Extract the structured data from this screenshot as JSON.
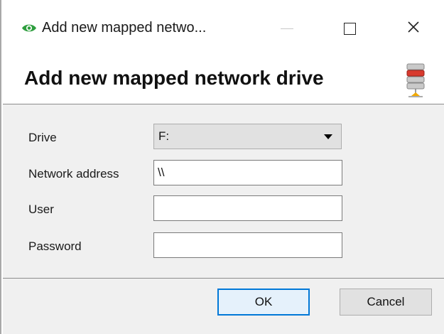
{
  "window": {
    "title": "Add new mapped netwo...",
    "app_icon": "eye-icon",
    "controls": {
      "minimize": "minimize-icon",
      "maximize": "maximize-icon",
      "close_glyph": "✕"
    }
  },
  "header": {
    "title": "Add new mapped network drive",
    "icon": "server-icon"
  },
  "form": {
    "drive": {
      "label": "Drive",
      "value": "F:"
    },
    "network_address": {
      "label": "Network address",
      "value": "\\\\"
    },
    "user": {
      "label": "User",
      "value": ""
    },
    "password": {
      "label": "Password",
      "value": ""
    }
  },
  "buttons": {
    "ok_label": "OK",
    "cancel_label": "Cancel"
  },
  "colors": {
    "app_icon_green": "#2e9e3e",
    "primary_button_border": "#0078d7",
    "primary_button_bg": "#e5f1fb",
    "panel_bg": "#f0f0f0"
  }
}
